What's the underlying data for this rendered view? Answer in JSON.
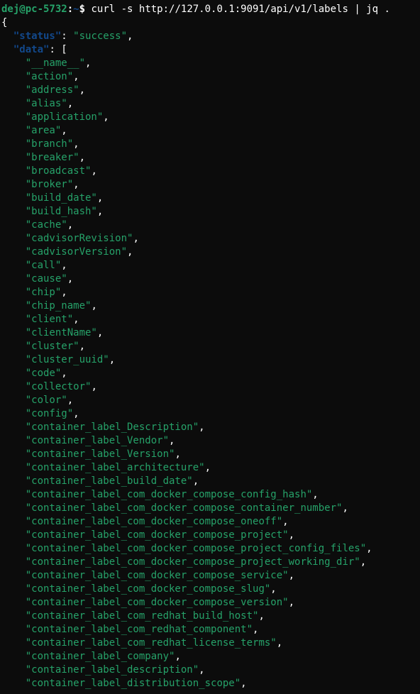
{
  "prompt": {
    "user_host": "dej@pc-5732",
    "colon": ":",
    "path": "~",
    "dollar": "$"
  },
  "command": " curl -s http://127.0.0.1:9091/api/v1/labels | jq .",
  "json": {
    "open_brace": "{",
    "status_key": "\"status\"",
    "status_sep": ": ",
    "status_val": "\"success\"",
    "data_key": "\"data\"",
    "data_sep": ": ",
    "data_open": "[",
    "items": [
      "\"__name__\"",
      "\"action\"",
      "\"address\"",
      "\"alias\"",
      "\"application\"",
      "\"area\"",
      "\"branch\"",
      "\"breaker\"",
      "\"broadcast\"",
      "\"broker\"",
      "\"build_date\"",
      "\"build_hash\"",
      "\"cache\"",
      "\"cadvisorRevision\"",
      "\"cadvisorVersion\"",
      "\"call\"",
      "\"cause\"",
      "\"chip\"",
      "\"chip_name\"",
      "\"client\"",
      "\"clientName\"",
      "\"cluster\"",
      "\"cluster_uuid\"",
      "\"code\"",
      "\"collector\"",
      "\"color\"",
      "\"config\"",
      "\"container_label_Description\"",
      "\"container_label_Vendor\"",
      "\"container_label_Version\"",
      "\"container_label_architecture\"",
      "\"container_label_build_date\"",
      "\"container_label_com_docker_compose_config_hash\"",
      "\"container_label_com_docker_compose_container_number\"",
      "\"container_label_com_docker_compose_oneoff\"",
      "\"container_label_com_docker_compose_project\"",
      "\"container_label_com_docker_compose_project_config_files\"",
      "\"container_label_com_docker_compose_project_working_dir\"",
      "\"container_label_com_docker_compose_service\"",
      "\"container_label_com_docker_compose_slug\"",
      "\"container_label_com_docker_compose_version\"",
      "\"container_label_com_redhat_build_host\"",
      "\"container_label_com_redhat_component\"",
      "\"container_label_com_redhat_license_terms\"",
      "\"container_label_company\"",
      "\"container_label_description\"",
      "\"container_label_distribution_scope\""
    ],
    "comma": ","
  }
}
